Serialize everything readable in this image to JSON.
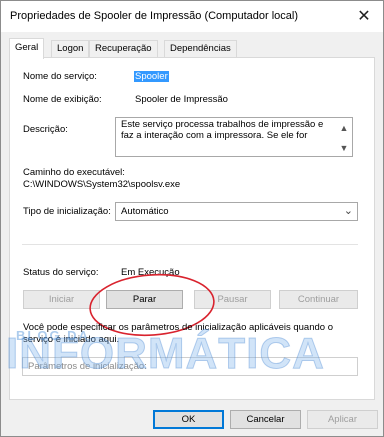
{
  "window": {
    "title": "Propriedades de Spooler de Impressão (Computador local)",
    "close_glyph": "✕"
  },
  "tabs": [
    {
      "label": "Geral",
      "active": true
    },
    {
      "label": "Logon",
      "active": false
    },
    {
      "label": "Recuperação",
      "active": false
    },
    {
      "label": "Dependências",
      "active": false
    }
  ],
  "general": {
    "service_name_label": "Nome do serviço:",
    "service_name_value": "Spooler",
    "display_name_label": "Nome de exibição:",
    "display_name_value": "Spooler de Impressão",
    "description_label": "Descrição:",
    "description_value": "Este serviço processa trabalhos de impressão e faz a interação com a impressora. Se ele for",
    "path_label": "Caminho do executável:",
    "path_value": "C:\\WINDOWS\\System32\\spoolsv.exe",
    "startup_type_label": "Tipo de inicialização:",
    "startup_type_value": "Automático",
    "status_label": "Status do serviço:",
    "status_value": "Em Execução",
    "buttons": {
      "start": "Iniciar",
      "stop": "Parar",
      "pause": "Pausar",
      "resume": "Continuar"
    },
    "param_hint": "Você pode especificar os parâmetros de inicialização aplicáveis quando o serviço é iniciado aqui.",
    "param_label": "Parâmetros de inicialização:"
  },
  "footer": {
    "ok": "OK",
    "cancel": "Cancelar",
    "apply": "Aplicar"
  },
  "watermark": {
    "line1": "BLOG DA",
    "line2": "INFORMÁTICA"
  },
  "colors": {
    "selection": "#3399ff",
    "annotation": "#d9232e",
    "default_button_border": "#0078d7"
  }
}
